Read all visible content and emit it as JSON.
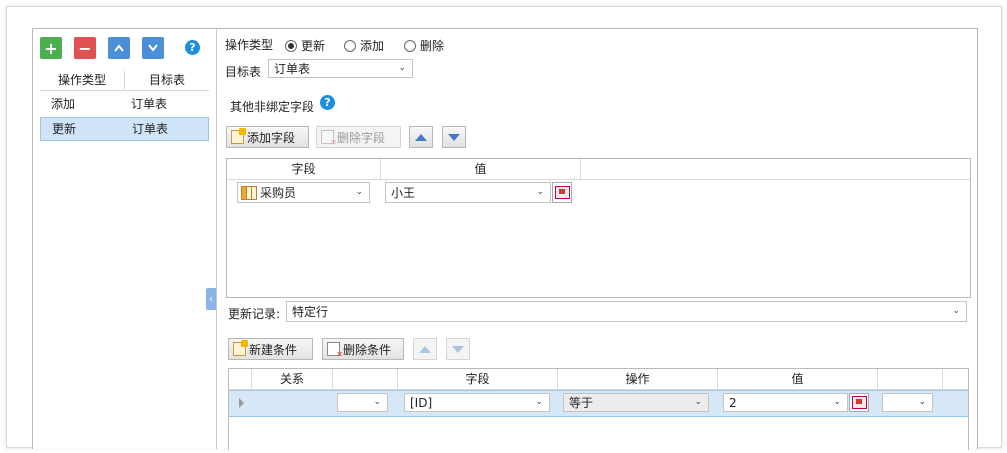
{
  "left": {
    "toolbar": {
      "add": "+",
      "remove": "−",
      "up": "⌃",
      "down": "⌄",
      "help": "?"
    },
    "columns": [
      "操作类型",
      "目标表"
    ],
    "rows": [
      {
        "op": "添加",
        "table": "订单表",
        "selected": false
      },
      {
        "op": "更新",
        "table": "订单表",
        "selected": true
      }
    ]
  },
  "right": {
    "op_type_label": "操作类型",
    "radio_update": "更新",
    "radio_add": "添加",
    "radio_delete": "删除",
    "selected_op": "更新",
    "target_label": "目标表",
    "target_value": "订单表",
    "other_fields_label": "其他非绑定字段",
    "add_field_btn": "添加字段",
    "delete_field_btn": "删除字段",
    "fields_grid": {
      "headers": [
        "字段",
        "值"
      ],
      "rows": [
        {
          "field": "采购员",
          "value": "小王"
        }
      ]
    },
    "update_records_label": "更新记录:",
    "update_records_value": "特定行",
    "new_condition_btn": "新建条件",
    "delete_condition_btn": "删除条件",
    "cond_grid": {
      "headers": [
        "关系",
        "字段",
        "操作",
        "值"
      ],
      "rows": [
        {
          "relation": "",
          "field": "[ID]",
          "operator": "等于",
          "value": "2",
          "extra": ""
        }
      ]
    }
  },
  "colors": {
    "add": "#4caf50",
    "remove": "#e05252",
    "move": "#4a8fd8",
    "help": "#1c8fe0",
    "selection": "#cfe5f7"
  }
}
